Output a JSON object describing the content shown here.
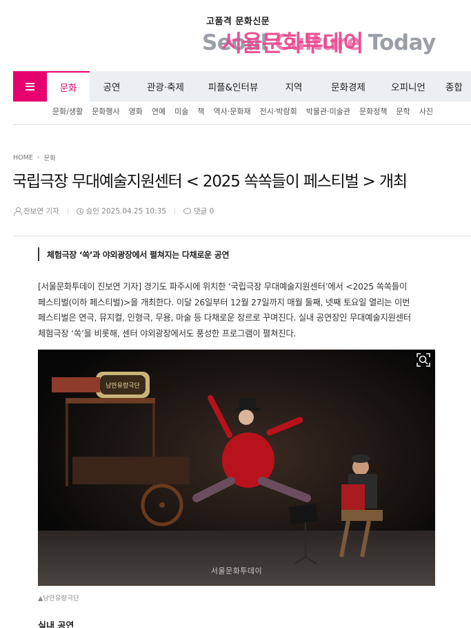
{
  "header": {
    "tagline": "고품격 문화신문",
    "logo_ko": "서울문화투데이",
    "logo_en_a": "Seoul ",
    "logo_en_b": "Culture",
    "logo_en_c": " Today"
  },
  "nav": {
    "menu_icon": "hamburger-icon",
    "items": [
      {
        "label": "문화"
      },
      {
        "label": "공연"
      },
      {
        "label": "관광·축제"
      },
      {
        "label": "피플&인터뷰"
      },
      {
        "label": "지역"
      },
      {
        "label": "문화경제"
      },
      {
        "label": "오피니언"
      },
      {
        "label": "종합"
      }
    ],
    "accent": "#e5006e"
  },
  "subnav": {
    "items": [
      "문화/생활",
      "문화행사",
      "영화",
      "연예",
      "미술",
      "책",
      "역사·문화재",
      "전시·박람회",
      "박물관·미술관",
      "문화정책",
      "문학",
      "사진"
    ]
  },
  "breadcrumb": {
    "home": "HOME",
    "section": "문화"
  },
  "article": {
    "title": "국립극장 무대예술지원센터 < 2025 쏙쏙들이 페스티벌 > 개최",
    "author": "진보연 기자",
    "approved": "승인 2025.04.25 10:35",
    "comments": "댓글 0",
    "subtitle": "체험극장 ‘쏙’과 야외광장에서 펼쳐지는 다채로운 공연",
    "body": "[서울문화투데이 진보연 기자] 경기도 파주시에 위치한 ‘국립극장 무대예술지원센터’에서 <2025 쏙쏙들이 페스티벌(이하 페스티벌)>을 개최한다. 이달 26일부터 12월 27일까지 매월 둘째, 넷째 토요일 열리는 이번 페스티벌은 연극, 뮤지컬, 인형극, 무용, 마술 등 다채로운 장르로 꾸며진다. 실내 공연장인 무대예술지원센터 체험극장 ‘쏙’을 비롯해, 센터 야외광장에서도 풍성한 프로그램이 펼쳐진다.",
    "photo_sign": "낭만유랑극단",
    "photo_watermark": "서울문화투데이",
    "caption": "▲낭만유랑극단",
    "section_head": "실내 공연"
  }
}
